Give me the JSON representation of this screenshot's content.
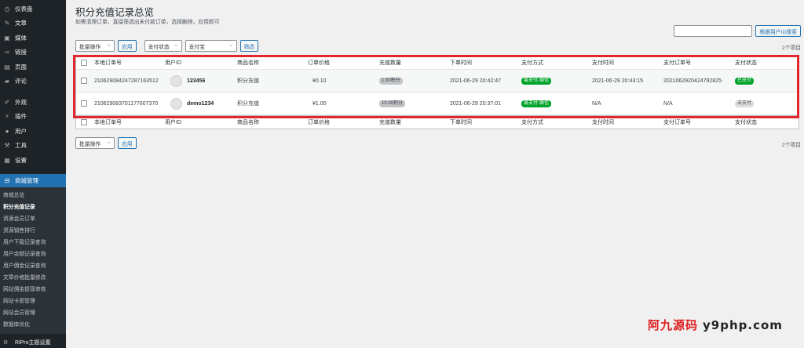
{
  "sidebar": {
    "top_items": [
      {
        "icon": "dashboard-icon",
        "glyph": "◷",
        "label": "仪表盘"
      },
      {
        "icon": "pin-icon",
        "glyph": "✎",
        "label": "文章"
      },
      {
        "icon": "media-icon",
        "glyph": "▣",
        "label": "媒体"
      },
      {
        "icon": "link-icon",
        "glyph": "∞",
        "label": "链接"
      },
      {
        "icon": "page-icon",
        "glyph": "▤",
        "label": "页面"
      },
      {
        "icon": "comment-icon",
        "glyph": "▰",
        "label": "评论"
      }
    ],
    "mid_items": [
      {
        "icon": "appearance-icon",
        "glyph": "✐",
        "label": "外观"
      },
      {
        "icon": "plugin-icon",
        "glyph": "⚡",
        "label": "插件"
      },
      {
        "icon": "user-icon",
        "glyph": "●",
        "label": "用户"
      },
      {
        "icon": "tools-icon",
        "glyph": "⚒",
        "label": "工具"
      },
      {
        "icon": "settings-icon",
        "glyph": "▦",
        "label": "设置"
      }
    ],
    "active": {
      "icon": "cart-icon",
      "glyph": "🛒",
      "label": "商城管理"
    },
    "submenu": [
      "商城总览",
      "积分充值记录",
      "资源会员订单",
      "资源销售排行",
      "用户下载记录查询",
      "用户余额记录查询",
      "用户佣金记录查询",
      "文章价格批量修改",
      "网站佣金提现审核",
      "网站卡密管理",
      "网站会员管理",
      "数据库优化"
    ],
    "current_sub": 1,
    "bottom": {
      "icon": "gear-icon",
      "glyph": "⚙",
      "label": "RiPro主题设置"
    }
  },
  "page": {
    "title": "积分充值记录总览",
    "subtitle": "如需清理订单，直接筛选出未付款订单，选择删除，应用即可",
    "search_placeholder": "",
    "search_button": "根据用户ID搜索",
    "bulk_action": "批量操作",
    "apply": "应用",
    "status_filter": "支付状态",
    "method_filter": "支付宝",
    "filter_button": "筛选",
    "items_count": "2个项目"
  },
  "table": {
    "columns": [
      "本地订单号",
      "用户ID",
      "商品名称",
      "订单价格",
      "充值数量",
      "下单时间",
      "支付方式",
      "支付时间",
      "支付订单号",
      "支付状态"
    ],
    "rows": [
      {
        "order_id": "210629084247287163512",
        "user": "123456",
        "product": "积分充值",
        "price": "¥0.10",
        "amount": "1.00积分",
        "order_time": "2021-06-29 20:42:47",
        "method": "易支付-微信",
        "pay_time": "2021-06-29 20:43:15",
        "pay_order": "2021062920424792825",
        "status": "已支付",
        "status_color": "#00a32a"
      },
      {
        "order_id": "210629083701177607370",
        "user": "demo1234",
        "product": "积分充值",
        "price": "¥1.00",
        "amount": "10.00积分",
        "order_time": "2021-06-29 20:37:01",
        "method": "易支付-微信",
        "pay_time": "N/A",
        "pay_order": "N/A",
        "status": "未支付",
        "status_color": "#dcdcde"
      }
    ]
  },
  "watermark": {
    "cn": "阿九源码",
    "domain": "y9php.com"
  },
  "colors": {
    "sidebar": "#1d2327",
    "accent": "#2271b1",
    "highlight": "#e1262e",
    "paid": "#00a32a"
  }
}
